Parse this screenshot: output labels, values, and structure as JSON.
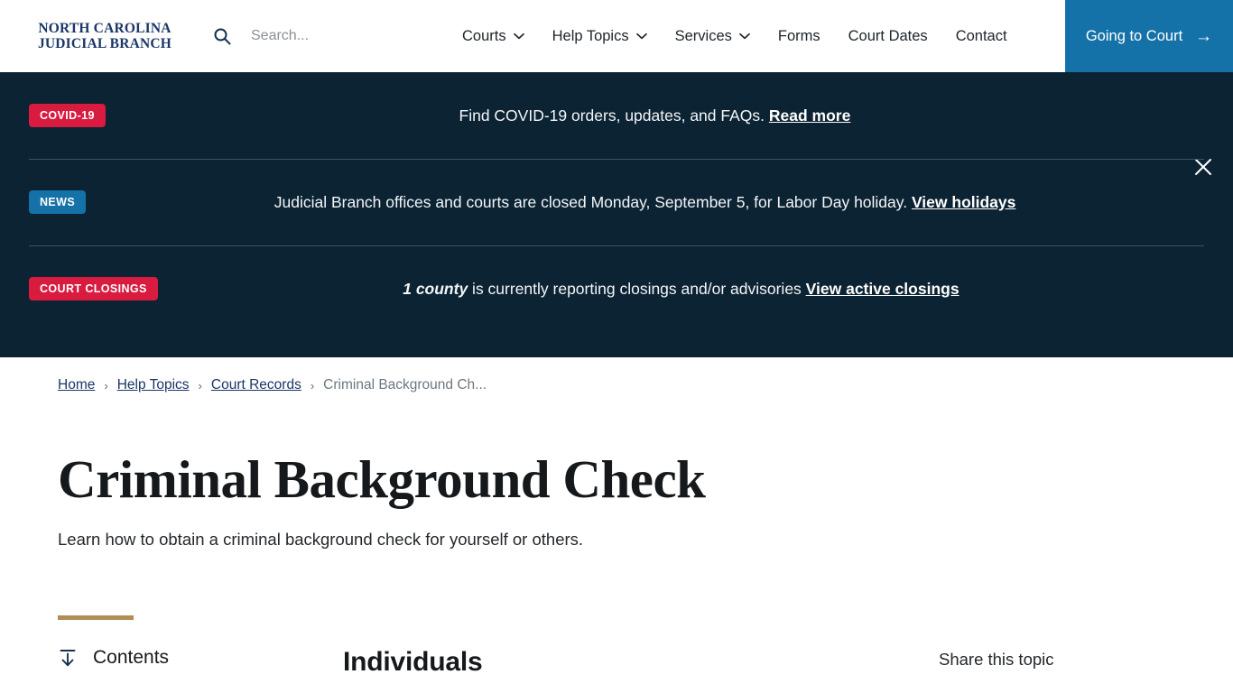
{
  "header": {
    "logo_line1": "NORTH CAROLINA",
    "logo_line2": "JUDICIAL BRANCH",
    "search_placeholder": "Search...",
    "search_value": "",
    "nav": [
      {
        "label": "Courts",
        "has_dropdown": true
      },
      {
        "label": "Help Topics",
        "has_dropdown": true
      },
      {
        "label": "Services",
        "has_dropdown": true
      },
      {
        "label": "Forms",
        "has_dropdown": false
      },
      {
        "label": "Court Dates",
        "has_dropdown": false
      },
      {
        "label": "Contact",
        "has_dropdown": false
      }
    ],
    "cta_label": "Going to Court",
    "cta_arrow": "→",
    "cta_color": "#1572a8"
  },
  "alerts": {
    "close_label": "Close alerts",
    "background": "#0c2333",
    "items": [
      {
        "badge": "COVID-19",
        "badge_color": "#d81b3f",
        "text_before": "Find COVID-19 orders, updates, and FAQs. ",
        "link": "Read more",
        "text_after": ""
      },
      {
        "badge": "NEWS",
        "badge_color": "#1572a8",
        "text_before": "Judicial Branch offices and courts are closed Monday, September 5, for Labor Day holiday. ",
        "link": "View holidays",
        "text_after": ""
      },
      {
        "badge": "COURT CLOSINGS",
        "badge_color": "#d81b3f",
        "emphasis": "1 county",
        "text_before": " is currently reporting closings and/or advisories ",
        "link": "View active closings",
        "text_after": ""
      }
    ]
  },
  "breadcrumb": {
    "links": [
      "Home",
      "Help Topics",
      "Court Records"
    ],
    "separator": "›",
    "current": "Criminal Background Ch..."
  },
  "page": {
    "title": "Criminal Background Check",
    "subtitle": "Learn how to obtain a criminal background check for yourself or others.",
    "accent_color": "#b08d55"
  },
  "bottom": {
    "contents_label": "Contents",
    "section_heading": "Individuals",
    "share_label": "Share this topic"
  }
}
